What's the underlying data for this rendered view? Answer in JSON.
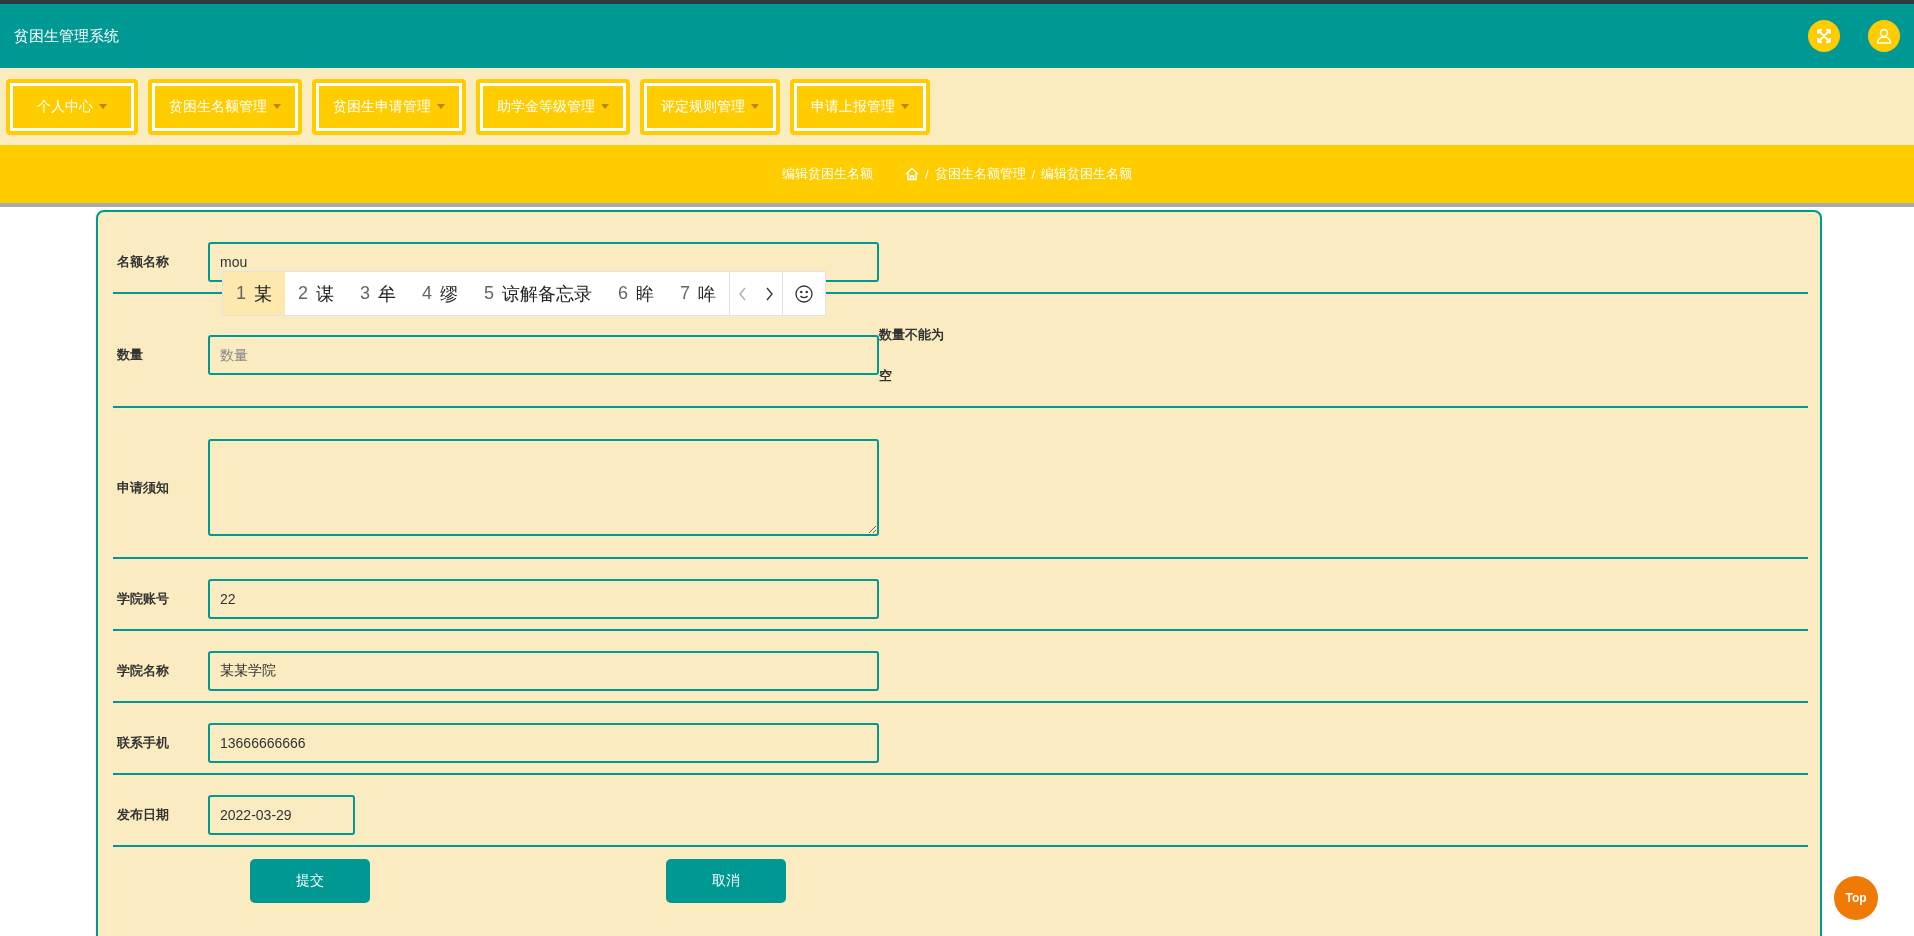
{
  "header": {
    "title": "贫困生管理系统"
  },
  "nav": [
    {
      "label": "个人中心"
    },
    {
      "label": "贫困生名额管理"
    },
    {
      "label": "贫困生申请管理"
    },
    {
      "label": "助学金等级管理"
    },
    {
      "label": "评定规则管理"
    },
    {
      "label": "申请上报管理"
    }
  ],
  "breadcrumb": {
    "page_title": "编辑贫困生名额",
    "separator": "/",
    "trail": [
      "贫困生名额管理",
      "编辑贫困生名额"
    ]
  },
  "form": {
    "fields": [
      {
        "kind": "text",
        "label": "名额名称",
        "value": "mou"
      },
      {
        "kind": "text",
        "label": "数量",
        "placeholder": "数量",
        "error": "数量不能为空"
      },
      {
        "kind": "textarea",
        "label": "申请须知"
      },
      {
        "kind": "text",
        "label": "学院账号",
        "value": "22"
      },
      {
        "kind": "text",
        "label": "学院名称",
        "value": "某某学院"
      },
      {
        "kind": "text",
        "label": "联系手机",
        "value": "13666666666"
      },
      {
        "kind": "date",
        "label": "发布日期",
        "value": "2022-03-29"
      }
    ],
    "buttons": [
      {
        "label": "提交"
      },
      {
        "label": "取消"
      }
    ]
  },
  "ime_candidates": [
    {
      "number": "1",
      "text": "某",
      "selected": true
    },
    {
      "number": "2",
      "text": "谋",
      "selected": false
    },
    {
      "number": "3",
      "text": "牟",
      "selected": false
    },
    {
      "number": "4",
      "text": "缪",
      "selected": false
    },
    {
      "number": "5",
      "text": "谅解备忘录",
      "selected": false
    },
    {
      "number": "6",
      "text": "眸",
      "selected": false
    },
    {
      "number": "7",
      "text": "哞",
      "selected": false
    }
  ],
  "back_to_top": {
    "label": "Top"
  }
}
